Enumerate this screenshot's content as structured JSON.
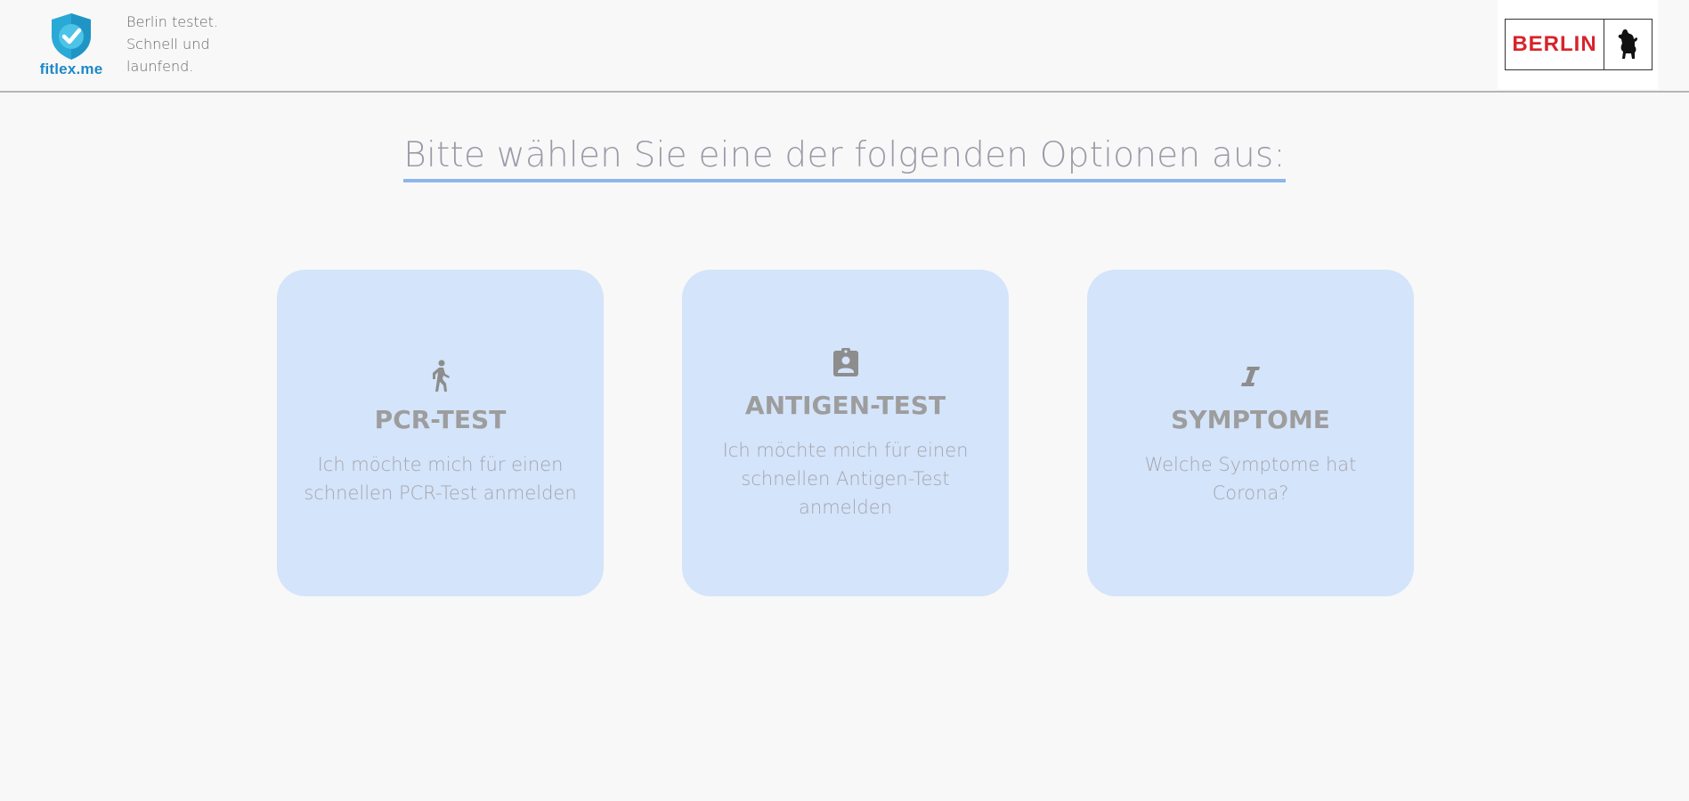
{
  "header": {
    "brand_name": "fitlex.me",
    "tagline": [
      "Berlin testet.",
      "Schnell und",
      "launfend."
    ],
    "partner_logo_text": "BERLIN"
  },
  "prompt": {
    "text": "Bitte wählen Sie eine der folgenden Optionen aus:"
  },
  "options": [
    {
      "icon": "person-walking-icon",
      "title": "PCR-TEST",
      "description": "Ich möchte mich für einen schnellen PCR-Test anmelden"
    },
    {
      "icon": "assignment-ind-icon",
      "title": "ANTIGEN-TEST",
      "description": "Ich möchte mich für einen schnellen Antigen-Test anmelden"
    },
    {
      "icon": "italic-i-icon",
      "title": "SYMPTOME",
      "description": "Welche Symptome hat Corona?"
    }
  ],
  "colors": {
    "background": "#f8f8f8",
    "card_background": "#d4e4fa",
    "prompt_underline": "#8eb6ea",
    "brand_blue": "#1e88c7",
    "berlin_red": "#d8232a"
  }
}
